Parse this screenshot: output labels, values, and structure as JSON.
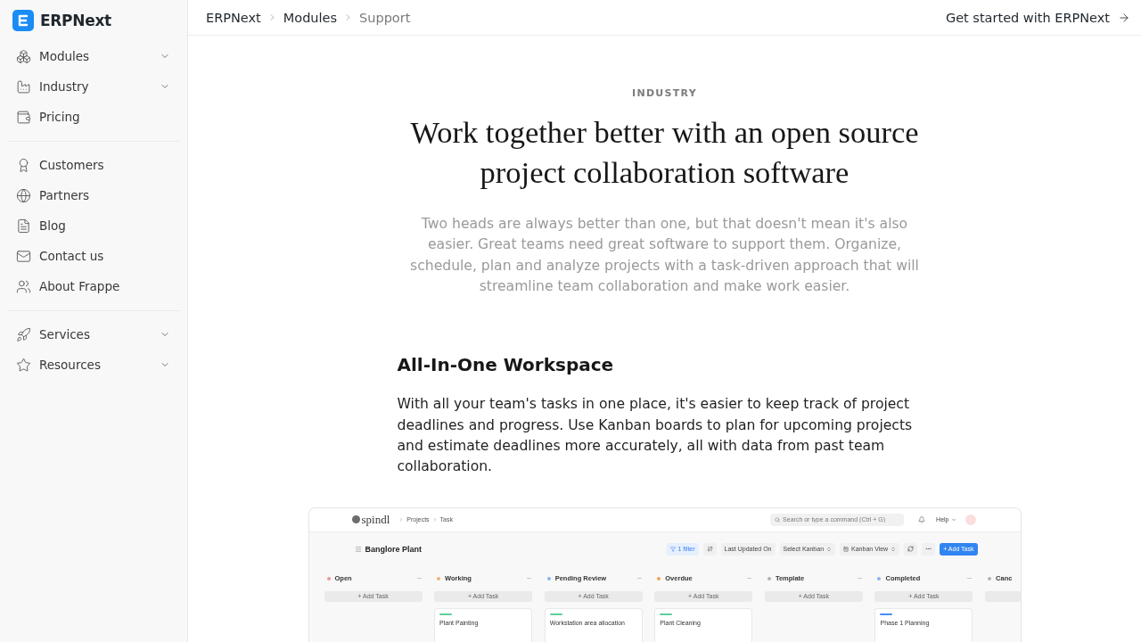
{
  "sidebar": {
    "logo": "ERPNext",
    "groups": [
      {
        "items": [
          {
            "label": "Modules",
            "kind": "menu"
          },
          {
            "label": "Industry",
            "kind": "menu"
          },
          {
            "label": "Pricing",
            "kind": "link"
          }
        ]
      },
      {
        "items": [
          {
            "label": "Customers",
            "kind": "link"
          },
          {
            "label": "Partners",
            "kind": "link"
          },
          {
            "label": "Blog",
            "kind": "link"
          },
          {
            "label": "Contact us",
            "kind": "link"
          },
          {
            "label": "About Frappe",
            "kind": "link"
          }
        ]
      },
      {
        "items": [
          {
            "label": "Services",
            "kind": "menu"
          },
          {
            "label": "Resources",
            "kind": "menu"
          }
        ]
      }
    ]
  },
  "breadcrumb": [
    {
      "label": "ERPNext",
      "current": false
    },
    {
      "label": "Modules",
      "current": false
    },
    {
      "label": "Support",
      "current": true
    }
  ],
  "cta": {
    "label": "Get started with ERPNext"
  },
  "hero": {
    "eyebrow": "INDUSTRY",
    "title": "Work together better with an open source project collaboration software",
    "intro": "Two heads are always better than one, but that doesn't mean it's also easier. Great teams need great software to support them. Organize, schedule, plan and analyze projects with a task-driven approach that will streamline team collaboration and make work easier."
  },
  "sections": [
    {
      "heading": "All-In-One Workspace",
      "body": "With all your team's tasks in one place, it's easier to keep track of project deadlines and progress. Use Kanban boards to plan for upcoming projects and estimate deadlines more accurately, all with data from past team collaboration."
    }
  ],
  "app_preview": {
    "logo": "spindl",
    "breadcrumb": [
      "Projects",
      "Task"
    ],
    "search": {
      "placeholder": "Search or type a command (Ctrl + G)"
    },
    "help": "Help",
    "title": "Banglore Plant",
    "toolbar": [
      {
        "kind": "filter",
        "label": "1 filter"
      },
      {
        "kind": "sort",
        "label": "Last Updated On"
      },
      {
        "kind": "select",
        "label": "Select Kanban"
      },
      {
        "kind": "view",
        "label": "Kanban View"
      },
      {
        "kind": "refresh"
      },
      {
        "kind": "more"
      },
      {
        "kind": "primary",
        "label": "+ Add Task"
      }
    ],
    "columns": [
      {
        "kind": "full",
        "name": "Open",
        "color": "#e79a9a",
        "add_label": "+ Add Task"
      },
      {
        "kind": "full",
        "name": "Working",
        "color": "#f2b27a",
        "add_label": "+ Add Task",
        "cards": [
          {
            "title": "Plant Painting",
            "color": "#5ccf9c"
          }
        ]
      },
      {
        "kind": "full",
        "name": "Pending Review",
        "color": "#8ab4ee",
        "add_label": "+ Add Task",
        "cards": [
          {
            "title": "Workstation area allocation",
            "color": "#5ccf9c"
          }
        ]
      },
      {
        "kind": "full",
        "name": "Overdue",
        "color": "#f3a552",
        "add_label": "+ Add Task",
        "cards": [
          {
            "title": "Plant Cleaning",
            "color": "#5ccf9c"
          }
        ]
      },
      {
        "kind": "full",
        "name": "Template",
        "color": "#b3b3b3",
        "add_label": "+ Add Task"
      },
      {
        "kind": "full",
        "name": "Completed",
        "color": "#8ab4ee",
        "add_label": "+ Add Task",
        "cards": [
          {
            "title": "Phase 1 Planning",
            "color": "#4b8df8"
          }
        ]
      },
      {
        "kind": "partial",
        "name": "Canc",
        "color": "#b3b3b3"
      }
    ]
  }
}
